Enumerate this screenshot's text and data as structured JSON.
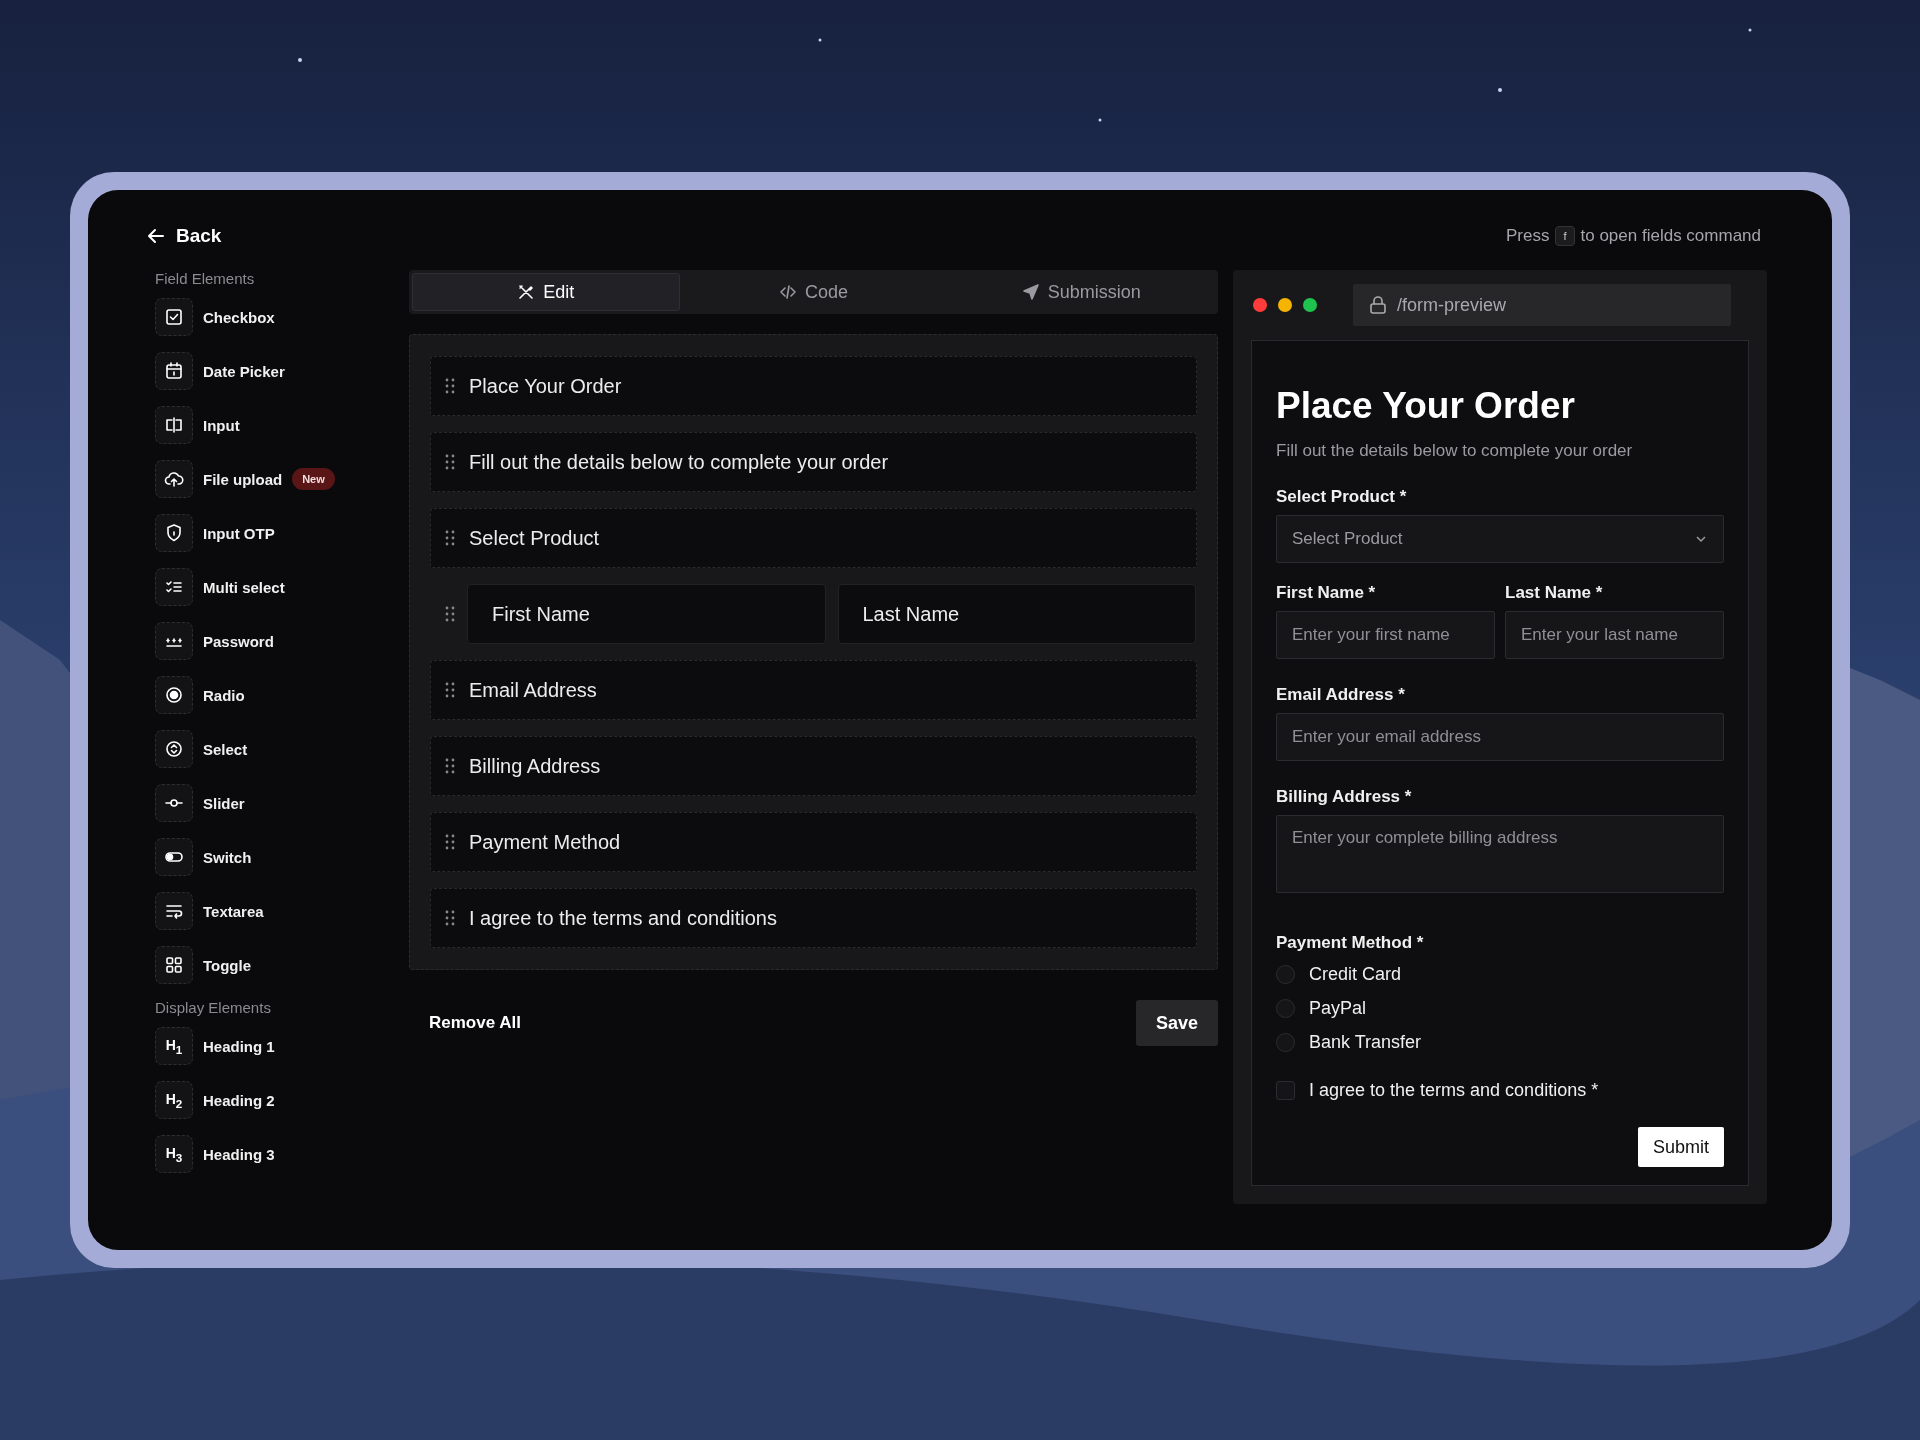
{
  "header": {
    "back": "Back",
    "hint_before": "Press",
    "key": "f",
    "hint_after": "to open fields command"
  },
  "sidebar": {
    "sections": [
      {
        "title": "Field Elements",
        "items": [
          {
            "label": "Checkbox",
            "kind": "checkbox"
          },
          {
            "label": "Date Picker",
            "kind": "calendar"
          },
          {
            "label": "Input",
            "kind": "input"
          },
          {
            "label": "File upload",
            "kind": "upload",
            "badge": "New"
          },
          {
            "label": "Input OTP",
            "kind": "shield"
          },
          {
            "label": "Multi select",
            "kind": "checklist"
          },
          {
            "label": "Password",
            "kind": "password"
          },
          {
            "label": "Radio",
            "kind": "radio"
          },
          {
            "label": "Select",
            "kind": "select"
          },
          {
            "label": "Slider",
            "kind": "slider"
          },
          {
            "label": "Switch",
            "kind": "switch"
          },
          {
            "label": "Textarea",
            "kind": "textarea"
          },
          {
            "label": "Toggle",
            "kind": "grid"
          }
        ]
      },
      {
        "title": "Display Elements",
        "items": [
          {
            "label": "Heading 1",
            "kind": "heading",
            "icon_text": "H$_{1}$"
          },
          {
            "label": "Heading 2",
            "kind": "heading",
            "icon_text": "H$_{2}$"
          },
          {
            "label": "Heading 3",
            "kind": "heading",
            "icon_text": "H$_{3}$"
          }
        ]
      }
    ]
  },
  "tabs": [
    {
      "label": "Edit",
      "kind": "edit",
      "selected": true
    },
    {
      "label": "Code",
      "kind": "code",
      "selected": false
    },
    {
      "label": "Submission",
      "kind": "send",
      "selected": false
    }
  ],
  "canvas": {
    "rows": [
      {
        "fields": [
          "Place Your Order"
        ]
      },
      {
        "fields": [
          "Fill out the details below to complete your order"
        ]
      },
      {
        "fields": [
          "Select Product"
        ]
      },
      {
        "fields": [
          "First Name",
          "Last Name"
        ]
      },
      {
        "fields": [
          "Email Address"
        ]
      },
      {
        "fields": [
          "Billing Address"
        ]
      },
      {
        "fields": [
          "Payment Method"
        ]
      },
      {
        "fields": [
          "I agree to the terms and conditions"
        ]
      }
    ]
  },
  "actions": {
    "remove": "Remove All",
    "save": "Save"
  },
  "preview": {
    "url": "/form-preview",
    "title": "Place Your Order",
    "subtitle": "Fill out the details below to complete your order",
    "fields": [
      {
        "kind": "select",
        "label": "Select Product *",
        "placeholder": "Select Product"
      },
      {
        "kind": "pair",
        "items": [
          {
            "label": "First Name *",
            "placeholder": "Enter your first name"
          },
          {
            "label": "Last Name *",
            "placeholder": "Enter your last name"
          }
        ]
      },
      {
        "kind": "input",
        "label": "Email Address *",
        "placeholder": "Enter your email address"
      },
      {
        "kind": "textarea",
        "label": "Billing Address *",
        "placeholder": "Enter your complete billing address"
      },
      {
        "kind": "radio",
        "label": "Payment Method *",
        "options": [
          {
            "label": "Credit Card",
            "selected": false
          },
          {
            "label": "PayPal",
            "selected": false
          },
          {
            "label": "Bank Transfer",
            "selected": false
          }
        ]
      },
      {
        "kind": "checkbox",
        "label": "I agree to the terms and conditions *",
        "checked": false
      }
    ],
    "submit": "Submit"
  }
}
